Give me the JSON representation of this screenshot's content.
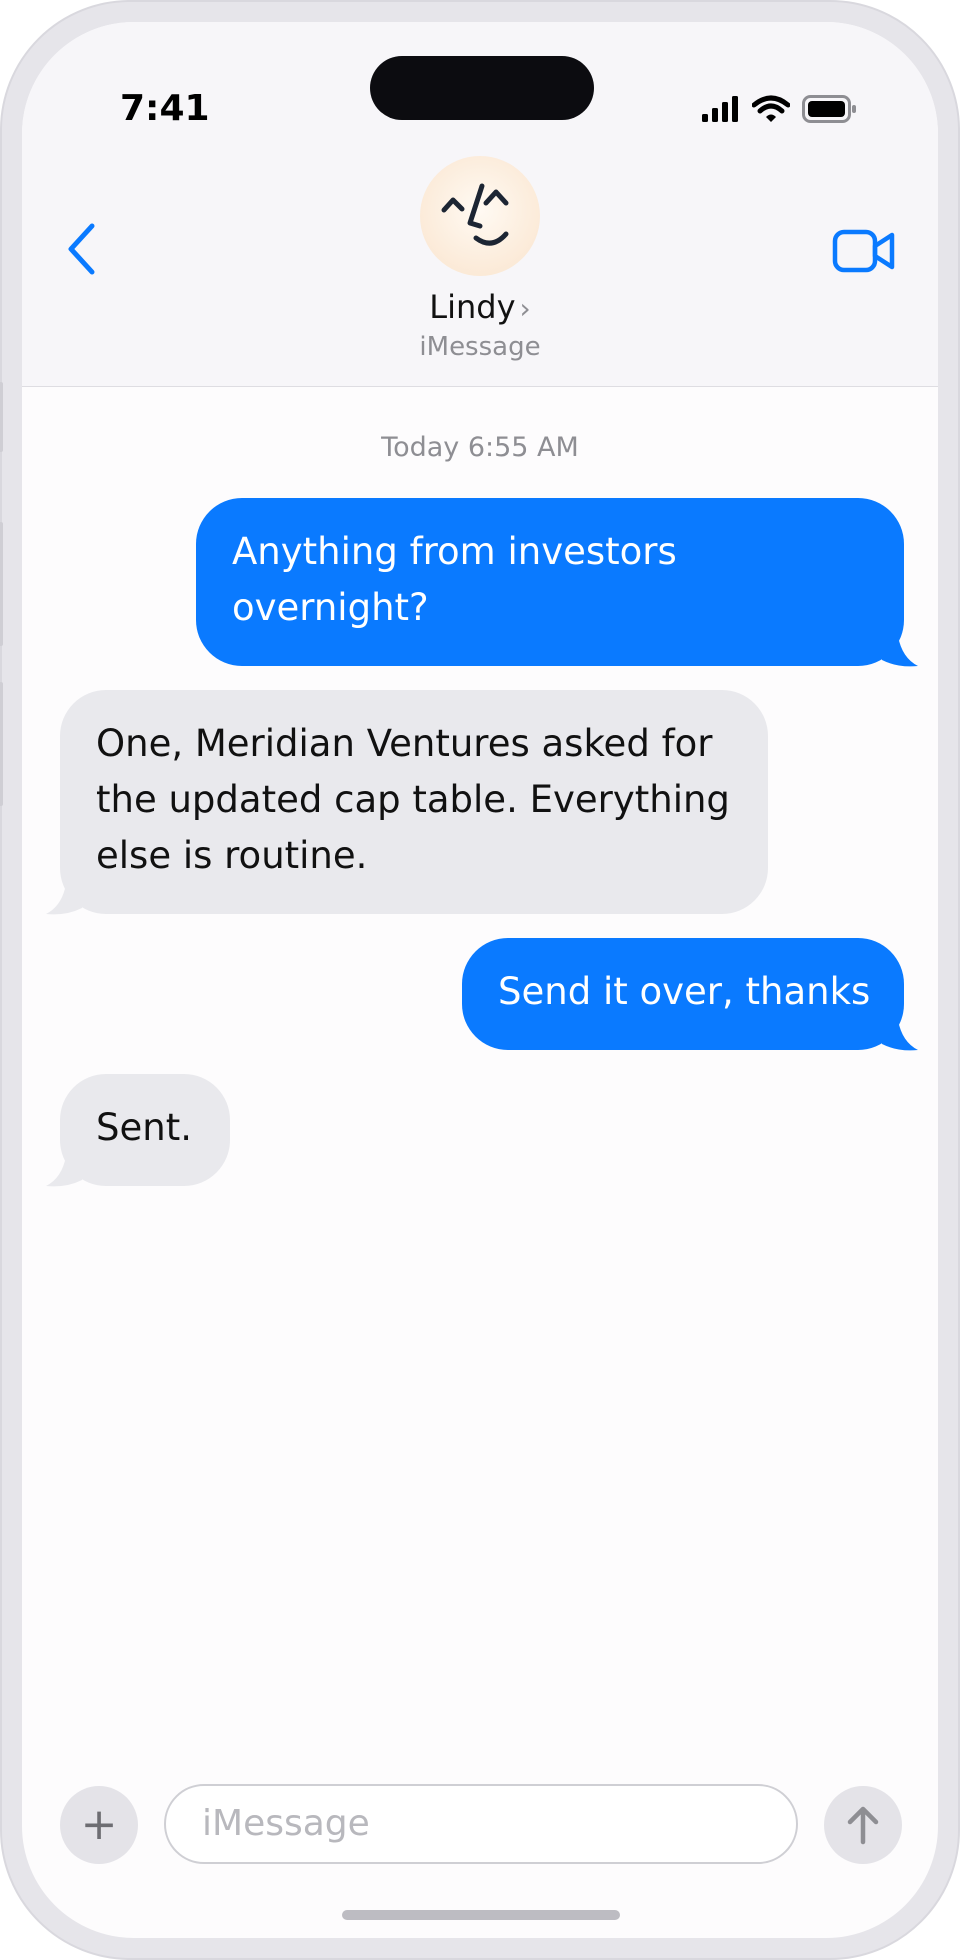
{
  "status_bar": {
    "time": "7:41"
  },
  "header": {
    "contact_name": "Lindy",
    "contact_chevron": "›",
    "service": "iMessage",
    "icons": {
      "back": "chevron-left-icon",
      "video": "video-camera-icon"
    },
    "accent_color": "#0a7aff"
  },
  "thread": {
    "timestamp": "Today 6:55 AM",
    "messages": [
      {
        "direction": "outgoing",
        "text": "Anything from investors overnight?"
      },
      {
        "direction": "incoming",
        "text": "One, Meridian Ventures asked for the updated cap table. Everything else is routine."
      },
      {
        "direction": "outgoing",
        "text": "Send it over, thanks"
      },
      {
        "direction": "incoming",
        "text": "Sent."
      }
    ]
  },
  "composer": {
    "plus_label": "+",
    "placeholder": "iMessage",
    "icons": {
      "add": "plus-icon",
      "send": "arrow-up-icon"
    }
  }
}
